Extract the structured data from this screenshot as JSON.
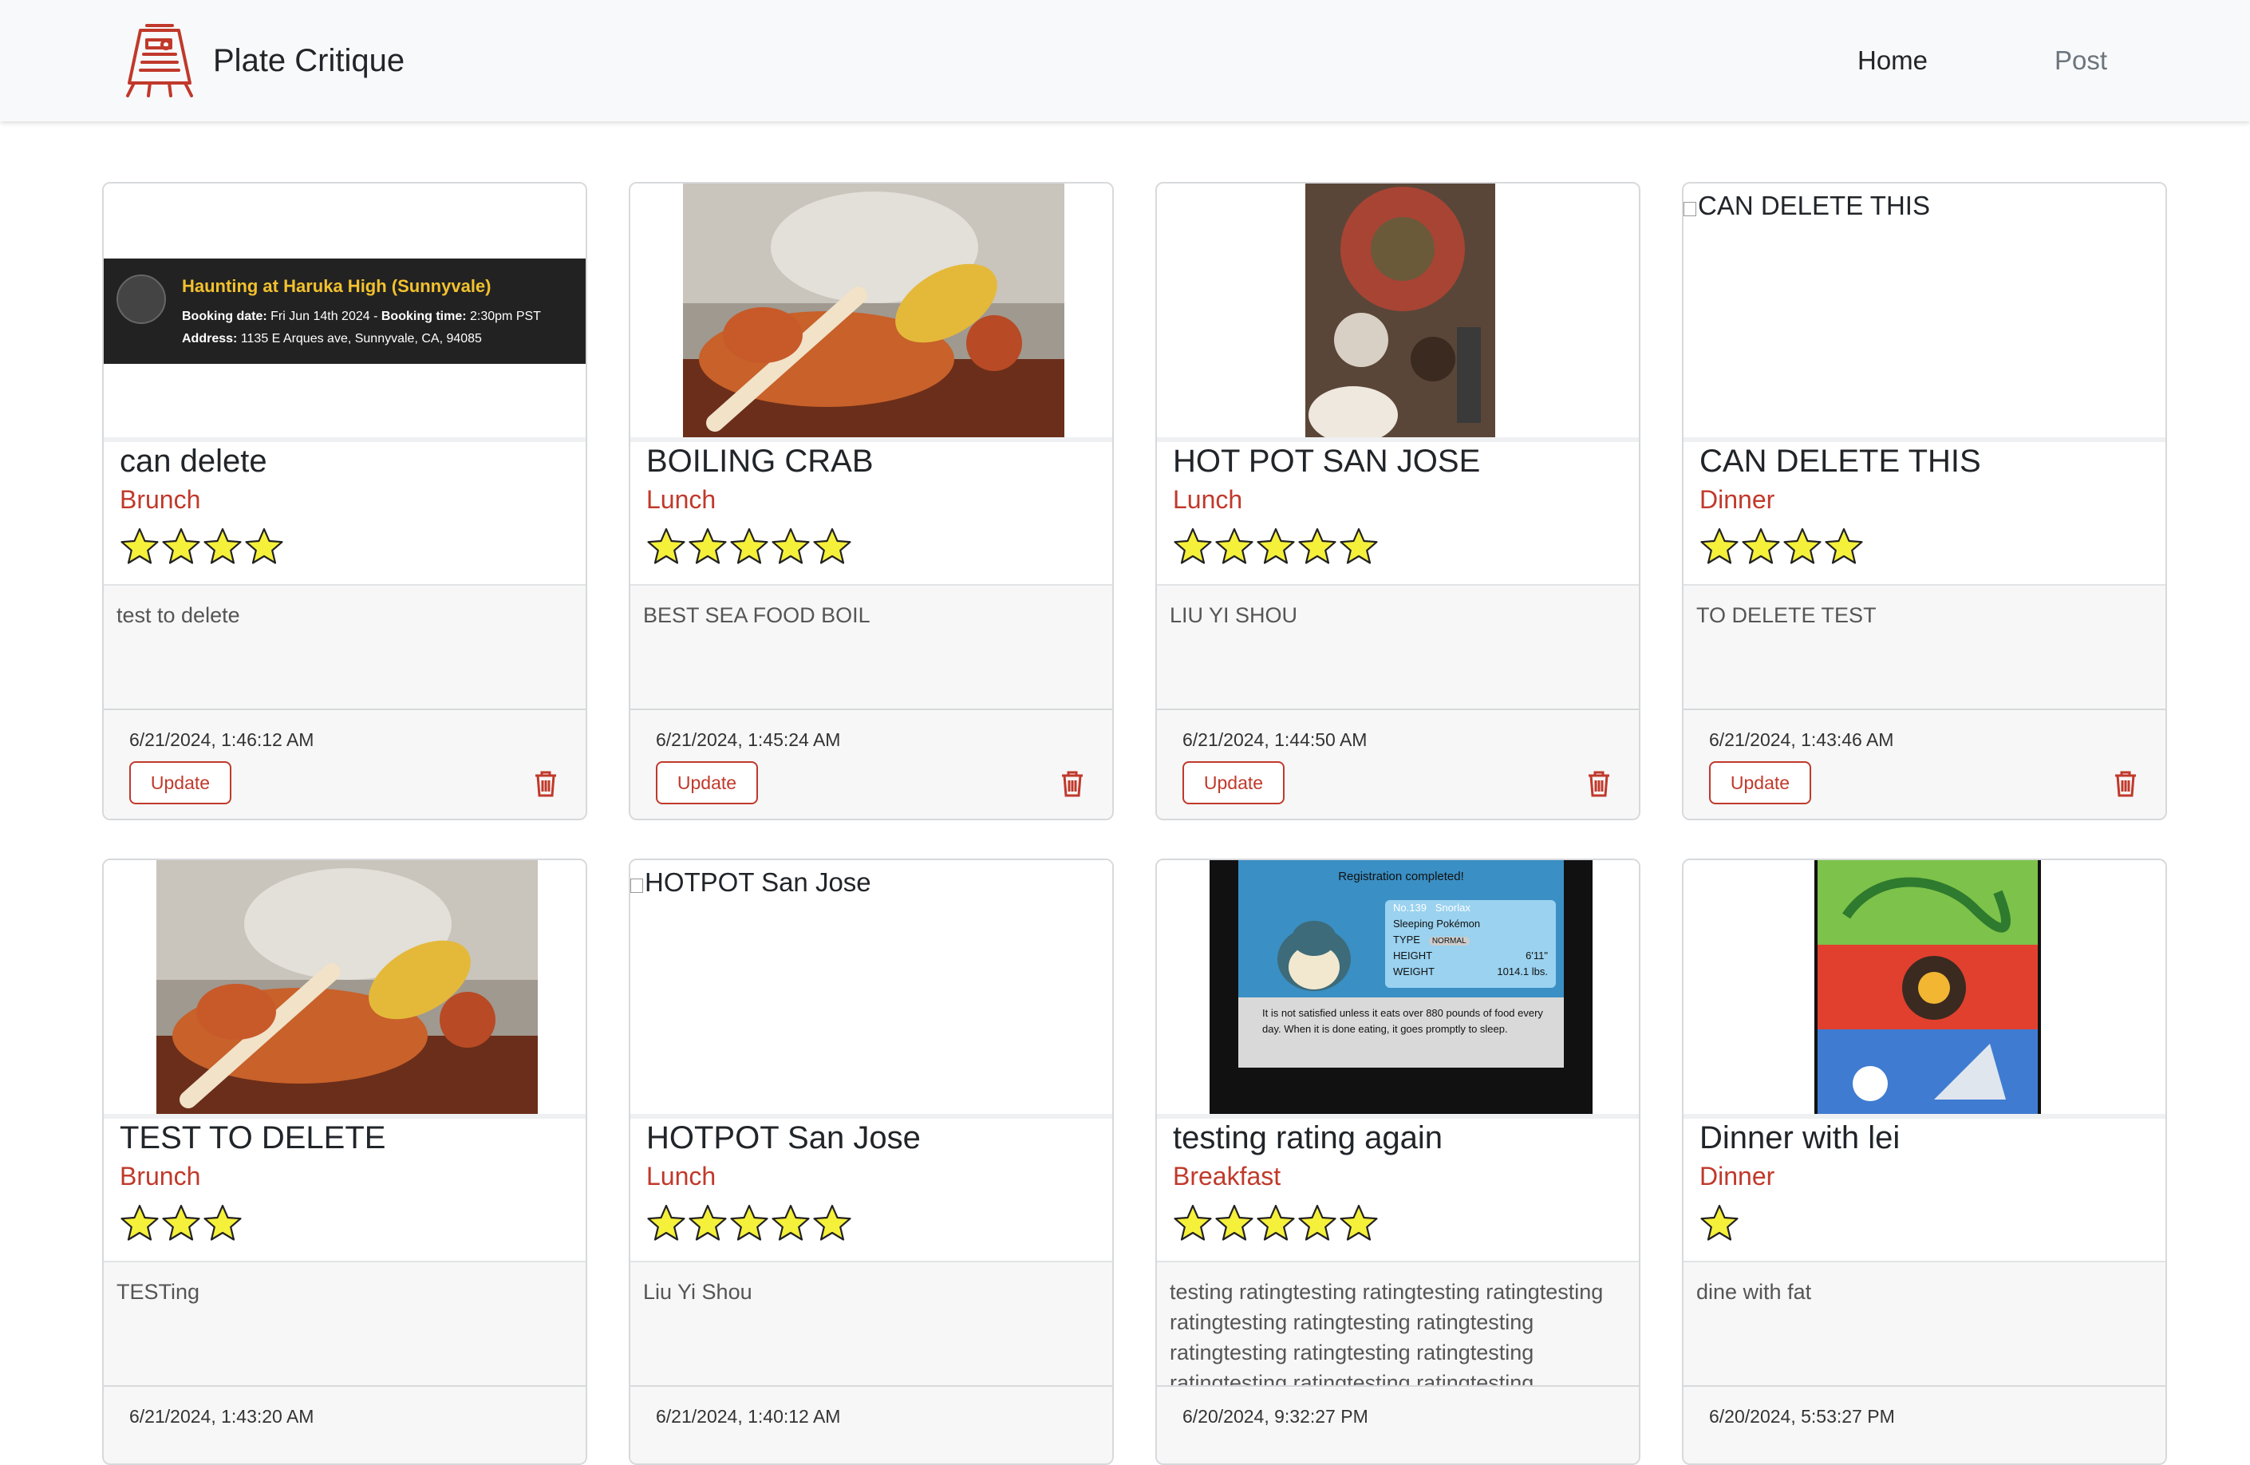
{
  "app": {
    "name": "Plate Critique"
  },
  "nav": {
    "home": "Home",
    "post": "Post"
  },
  "buttons": {
    "update": "Update"
  },
  "colors": {
    "accent": "#c0392b",
    "star_fill": "#f5f03a"
  },
  "cards": [
    {
      "title": "can delete",
      "meal": "Brunch",
      "rating": 4,
      "description": "test to delete",
      "date": "6/21/2024, 1:46:12 AM",
      "ticket": {
        "title": "Haunting at Haruka High (Sunnyvale)",
        "date_label": "Booking date:",
        "date_value": "Fri Jun 14th 2024 -",
        "time_label": "Booking time:",
        "time_value": "2:30pm PST",
        "addr_label": "Address:",
        "addr_value": "1135 E Arques ave, Sunnyvale, CA, 94085"
      }
    },
    {
      "title": "BOILING CRAB",
      "meal": "Lunch",
      "rating": 5,
      "description": "BEST SEA FOOD BOIL",
      "date": "6/21/2024, 1:45:24 AM"
    },
    {
      "title": "HOT POT SAN JOSE",
      "meal": "Lunch",
      "rating": 5,
      "description": "LIU YI SHOU",
      "date": "6/21/2024, 1:44:50 AM"
    },
    {
      "title": "CAN DELETE THIS",
      "meal": "Dinner",
      "rating": 4,
      "description": "TO DELETE TEST",
      "date": "6/21/2024, 1:43:46 AM",
      "image_alt": "CAN DELETE THIS"
    },
    {
      "title": "TEST TO DELETE",
      "meal": "Brunch",
      "rating": 3,
      "description": "TESTing",
      "date": "6/21/2024, 1:43:20 AM"
    },
    {
      "title": "HOTPOT San Jose",
      "meal": "Lunch",
      "rating": 5,
      "description": "Liu Yi Shou",
      "date": "6/21/2024, 1:40:12 AM",
      "image_alt": "HOTPOT San Jose"
    },
    {
      "title": "testing rating again",
      "meal": "Breakfast",
      "rating": 5,
      "description": "testing ratingtesting ratingtesting ratingtesting ratingtesting ratingtesting ratingtesting ratingtesting ratingtesting ratingtesting ratingtesting ratingtesting ratingtesting",
      "date": "6/20/2024, 9:32:27 PM",
      "screen": {
        "header": "Registration completed!",
        "no": "No.139",
        "name": "Snorlax",
        "species": "Sleeping Pokémon",
        "type_label": "TYPE",
        "type_value": "NORMAL",
        "height_label": "HEIGHT",
        "height_value": "6'11\"",
        "weight_label": "WEIGHT",
        "weight_value": "1014.1 lbs.",
        "text": "It is not satisfied unless it eats over 880 pounds of food every day. When it is done eating, it goes promptly to sleep."
      }
    },
    {
      "title": "Dinner with lei",
      "meal": "Dinner",
      "rating": 1,
      "description": "dine with fat",
      "date": "6/20/2024, 5:53:27 PM"
    }
  ]
}
